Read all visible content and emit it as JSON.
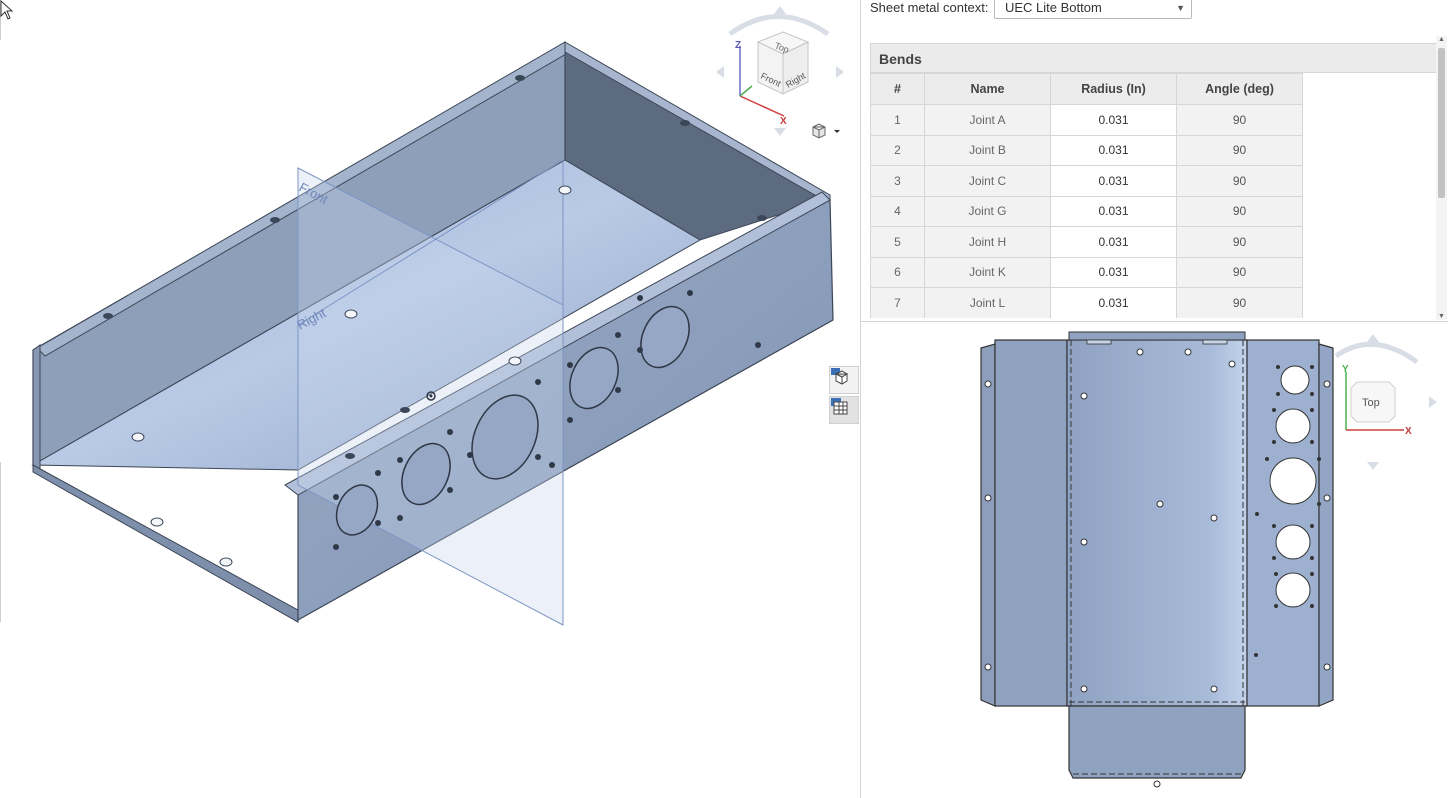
{
  "context": {
    "label": "Sheet metal context:",
    "selected": "UEC Lite Bottom"
  },
  "bends": {
    "title": "Bends",
    "columns": [
      "#",
      "Name",
      "Radius (In)",
      "Angle (deg)"
    ],
    "rows": [
      {
        "num": "1",
        "name": "Joint A",
        "radius": "0.031",
        "angle": "90"
      },
      {
        "num": "2",
        "name": "Joint B",
        "radius": "0.031",
        "angle": "90"
      },
      {
        "num": "3",
        "name": "Joint C",
        "radius": "0.031",
        "angle": "90"
      },
      {
        "num": "4",
        "name": "Joint G",
        "radius": "0.031",
        "angle": "90"
      },
      {
        "num": "5",
        "name": "Joint H",
        "radius": "0.031",
        "angle": "90"
      },
      {
        "num": "6",
        "name": "Joint K",
        "radius": "0.031",
        "angle": "90"
      },
      {
        "num": "7",
        "name": "Joint L",
        "radius": "0.031",
        "angle": "90"
      }
    ]
  },
  "viewport": {
    "plane_labels": {
      "front": "Front",
      "right": "Right"
    },
    "view_cube": {
      "top": "Top",
      "front": "Front",
      "right": "Right",
      "axis_z": "Z",
      "axis_x": "X"
    }
  },
  "flat_view": {
    "view_cube": {
      "top": "Top",
      "axis_y": "Y",
      "axis_x": "X"
    }
  },
  "colors": {
    "part_face": "#8fa3c2",
    "part_face_light": "#b7c8e3",
    "part_face_dark": "#5d6c82",
    "plane_blue": "#9fb6dc",
    "table_border": "#d6d6d6"
  }
}
